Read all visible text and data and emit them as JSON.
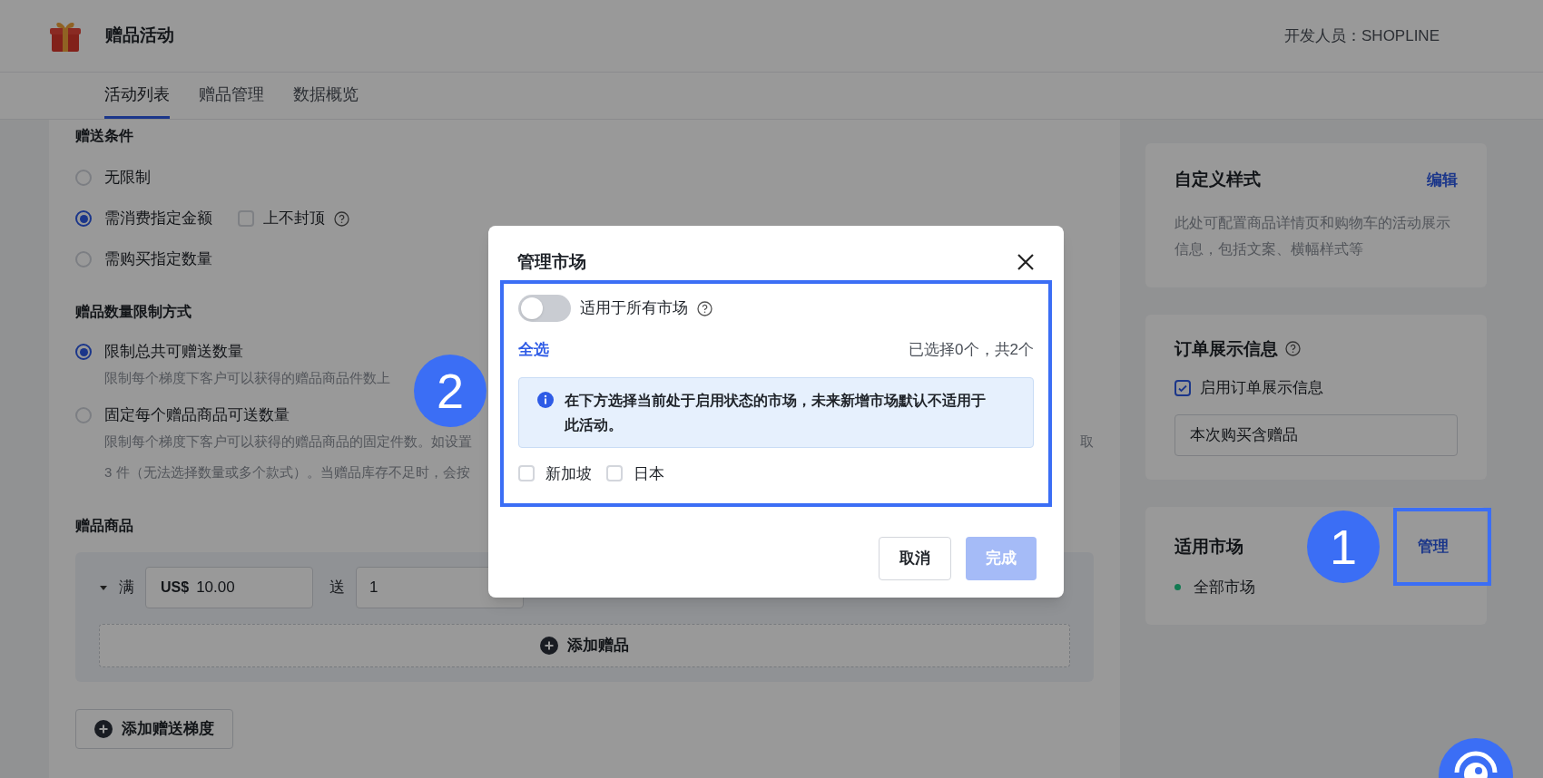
{
  "app": {
    "title": "赠品活动",
    "developer": "开发人员：SHOPLINE"
  },
  "tabs": [
    {
      "label": "活动列表",
      "selected": true
    },
    {
      "label": "赠品管理",
      "selected": false
    },
    {
      "label": "数据概览",
      "selected": false
    }
  ],
  "gift_conditions": {
    "heading": "赠送条件",
    "options": [
      {
        "label": "无限制",
        "selected": false
      },
      {
        "label": "需消费指定金额",
        "selected": true,
        "checkbox": {
          "label": "上不封顶",
          "checked": false
        }
      },
      {
        "label": "需购买指定数量",
        "selected": false
      }
    ]
  },
  "quantity_limit": {
    "heading": "赠品数量限制方式",
    "options": [
      {
        "label": "限制总共可赠送数量",
        "selected": true,
        "description": [
          "限制每个梯度下客户可以获得的赠品商品件数上"
        ]
      },
      {
        "label": "固定每个赠品商品可送数量",
        "selected": false,
        "description": [
          "限制每个梯度下客户可以获得的赠品商品的固定件数。如设置",
          "3 件（无法选择数量或多个款式）。当赠品库存不足时，会按"
        ],
        "description_tail": "取"
      }
    ]
  },
  "gift_products": {
    "heading": "赠品商品",
    "tier": {
      "expanded": true,
      "prefix": "满",
      "currency": "US$",
      "amount": "10.00",
      "give_label": "送",
      "quantity": "1"
    },
    "add_gift": "添加赠品",
    "add_tier": "添加赠送梯度"
  },
  "custom_style": {
    "title": "自定义样式",
    "action": "编辑",
    "description": "此处可配置商品详情页和购物车的活动展示信息，包括文案、横幅样式等"
  },
  "order_display": {
    "title": "订单展示信息",
    "checkbox": {
      "label": "启用订单展示信息",
      "checked": true
    },
    "value": "本次购买含赠品"
  },
  "markets": {
    "title": "适用市场",
    "action": "管理",
    "items": [
      {
        "label": "全部市场",
        "color": "#137a52"
      }
    ]
  },
  "modal": {
    "title": "管理市场",
    "all_markets": {
      "label": "适用于所有市场",
      "on": false
    },
    "select_all": "全选",
    "count": "已选择0个，共2个",
    "notice": "在下方选择当前处于启用状态的市场，未来新增市场默认不适用于此活动。",
    "markets": [
      {
        "label": "新加坡",
        "checked": false
      },
      {
        "label": "日本",
        "checked": false
      }
    ],
    "cancel": "取消",
    "done": {
      "label": "完成",
      "disabled": true
    }
  },
  "annotations": [
    {
      "number": "2"
    },
    {
      "number": "1"
    }
  ]
}
